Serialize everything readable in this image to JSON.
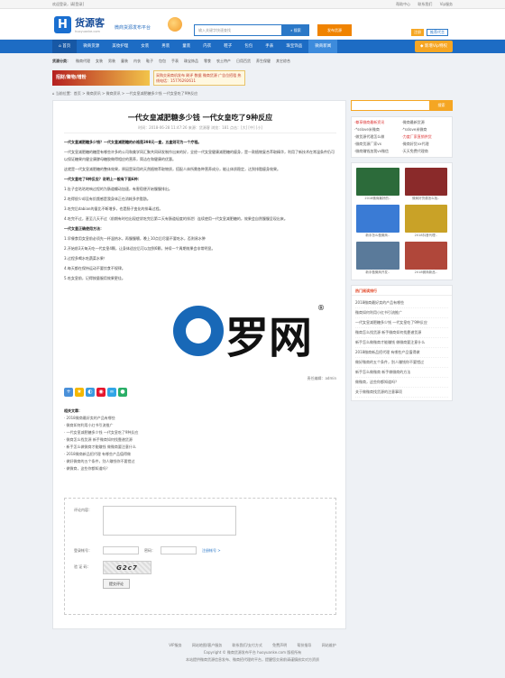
{
  "topbar": {
    "welcome": "欢迎登录，请[登录]",
    "links": [
      "帮助中心",
      "联系我们",
      "Vip服务"
    ]
  },
  "header": {
    "logo_char": "H",
    "site_name": "货源客",
    "domain": "huoyuanke.com",
    "slogan": "微商货源发布平台",
    "search_placeholder": "输入关键字快速查找",
    "search_button": "搜索",
    "publish_button": "发布货源",
    "mini_buttons": [
      "注册",
      "登录",
      "推荐代言"
    ]
  },
  "nav": {
    "items": [
      "首页",
      "微商货源",
      "美妆护理",
      "女装",
      "男装",
      "童装",
      "内衣",
      "鞋子",
      "包包",
      "手表",
      "珠宝饰品",
      "微商新闻"
    ],
    "vip": "新增Vip特权"
  },
  "subnav": {
    "label": "货源分类：",
    "items": [
      "微商代理",
      "女装",
      "男装",
      "童装",
      "内衣",
      "鞋子",
      "包包",
      "手表",
      "珠宝饰品",
      "零食",
      "农土特产",
      "日用百货",
      "养生保健",
      "其它综合"
    ]
  },
  "ads": {
    "ad1": "招财/聚物/增粉",
    "ad2": "采购交易商机发布 刷评 数据 微商货源 广告位招租 热线电话：15776292611"
  },
  "breadcrumb": "当前位置：首页 > 微商资讯 > 微商资讯 > 一代女皇减肥糖多少钱 一代女皇吃了9种反应",
  "article": {
    "title": "一代女皇减肥糖多少钱 一代女皇吃了9种反应",
    "meta": "时间：2018-06-28 11:47:26  来源：货源客  浏览：181  点击：[大] [中] [小]",
    "paragraphs": [
      {
        "bold": true,
        "text": "一代女皇减肥糖多少钱？一代女皇减肥糖的价格是398元一盒，五盒则可为一个疗程。"
      },
      {
        "bold": false,
        "text": "一代女皇减肥糖的糖是有哪些许多的公司和美学同汇聚共同研发制作出来的好，全经一代女皇健康减肥糖的瘦身，是一款植物复合萃取精华，利用了新技术在常温条件仍可以保证糖果内健全康酵母糖胶做得相应的营养，简洁在和健康的优惠。"
      },
      {
        "bold": false,
        "text": "这就是一代女皇减肥糖的整体效果，原因是采用的天然植物萃取物质，搭配人体所需各种营养成分，能让体质稳定，达到排脂瘦身效果。"
      },
      {
        "bold": true,
        "text": "一代女皇吃了9种反应？说明上一般有下面6种："
      },
      {
        "bold": false,
        "text": "1.肚子会咕咕地响过程的为肠道蠕动加速，有害宿便开始慢慢排出。"
      },
      {
        "bold": false,
        "text": "2.吃得很少却没有饥饿感是我身体正在消耗多余脂肪。"
      },
      {
        "bold": false,
        "text": "3.吃完后dabian的量比不断增多，也是肠子变化的排毒过程。"
      },
      {
        "bold": false,
        "text": "4.吃完不过，甚至几天不过（前期有时也出现症状吃完后第二天有肠道轻度的排泄）连续使用一代女皇减肥糖的，效果会自然慢慢呈现出来。"
      },
      {
        "bold": true,
        "text": "一代女皇正确使用方法："
      },
      {
        "bold": false,
        "text": "1.早餐食用女皇前必须先一杯温热水，再慢慢嚼，晚上10点后尽量不要吃水，否则易水肿"
      },
      {
        "bold": false,
        "text": "2.开始前3天每天吃一代女皇4颗，让身体适应后可以加到6颗，持续一个周期效果会非常明显。"
      },
      {
        "bold": false,
        "text": "3.过程多喝水吃蔬菜水果！"
      },
      {
        "bold": false,
        "text": "4.每天都在保持运动不要饮食不规律。"
      },
      {
        "bold": false,
        "text": "5.吃女皇前，记得按量服用效果更佳。"
      }
    ],
    "editor": "责任编辑：admin",
    "related_title": "相关文章：",
    "related": [
      "2018微商最好卖的产品有哪些",
      "微商如何利用小红书引流推广",
      "一代女皇减肥糖多少钱 一代女皇吃了9种反应",
      "微商怎么找货源 新手微商如何找靠谱货源",
      "新手怎么做微商才能赚钱 做微商要注意什么",
      "2018微商新品招代理 有哪些产品值得做",
      "做好微商的五个条件，别人赚钱你不要错过",
      "做微商，这些你都知道吗？"
    ]
  },
  "comment_form": {
    "content_label": "评论内容：",
    "username_label": "登录帐号：",
    "password_label": "密码：",
    "register_link": "注册帐号 >",
    "captcha_label": "验 证 码：",
    "captcha_text": "G2c7",
    "submit": "提交评论"
  },
  "sidebar": {
    "search_button": "搜索",
    "tags_title": "微商资讯",
    "tags": [
      "·尊享微商最新资讯",
      "·微商最新货源",
      "·*sslove米微商",
      "·*sslove米微商",
      "·做货源代理怎么做",
      "·力度厂家直销供货",
      "·微商货源厂家vx",
      "·微商好货vx代理",
      "·微商赚钱加我vx微信",
      "·天天免费代理商"
    ],
    "thumbs": [
      {
        "cap": "2018微商最好的..",
        "color": "#2c6b3a"
      },
      {
        "cap": "微商好货源怎么找..",
        "color": "#8a2a2a"
      },
      {
        "cap": "新手怎么做微商..",
        "color": "#3a7bd5"
      },
      {
        "cap": "2018抖音代理..",
        "color": "#c9a227"
      },
      {
        "cap": "新手做微商开发..",
        "color": "#5a7a9a"
      },
      {
        "cap": "2018微商新品..",
        "color": "#b0473a"
      }
    ],
    "rank_title": "热门阅读排行",
    "rank": [
      "2018微商最好卖的产品有哪些",
      "微商如何利用小红书引流推广",
      "一代女皇减肥糖多少钱 一代女皇吃了9种反应",
      "微商怎么找货源 新手微商如何找靠谱货源",
      "新手怎么做微商才能赚钱 做微商要注意什么",
      "2018微商新品招代理 有哪些产品值得做",
      "做好微商的五个条件，别人赚钱你不要错过",
      "新手怎么做微商 新手做微商的方法",
      "做微商，这些你都知道吗？",
      "关于做微商找货源的注意事项"
    ]
  },
  "watermark": {
    "text": "罗网",
    "reg": "®"
  },
  "footer": {
    "links": [
      "VIP服务",
      "网站地图/客户服务",
      "联系我们/支付方式",
      "免费声明",
      "帮扶指导",
      "网站维护"
    ],
    "copyright": "Copyright © 微商货源发布平台 huoyuanke.com  版权所有",
    "note": "本站提供微商货源信息发布、微商招代理的平台，提醒您交易前请谨慎核实对方资质"
  }
}
